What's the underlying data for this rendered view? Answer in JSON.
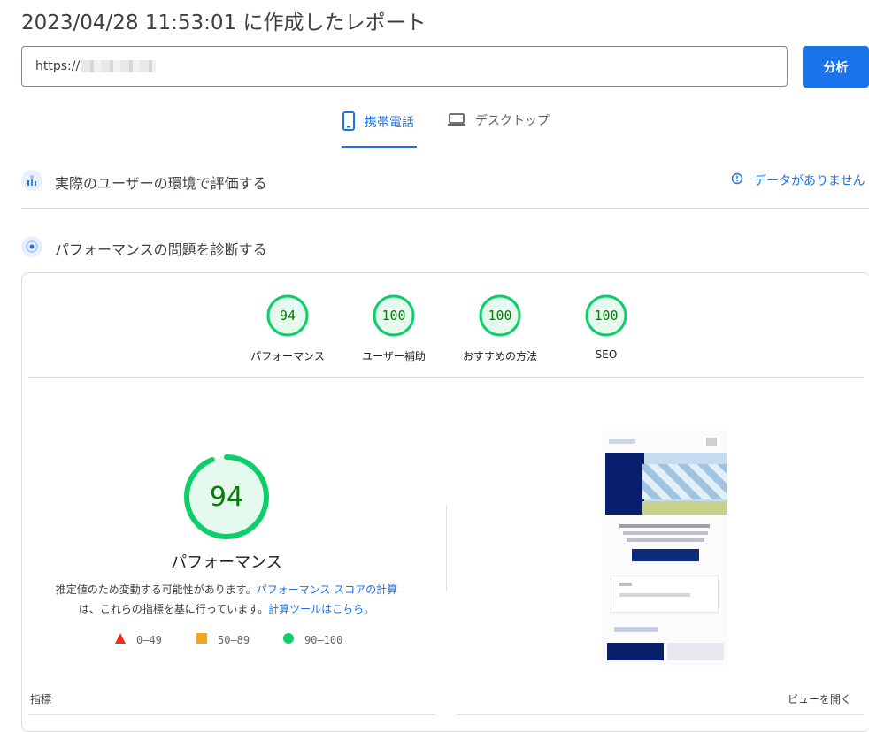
{
  "header": {
    "title": "2023/04/28 11:53:01 に作成したレポート",
    "url_value": "https://",
    "analyze_label": "分析"
  },
  "tabs": [
    {
      "label": "携帯電話",
      "icon": "smartphone-icon",
      "selected": true
    },
    {
      "label": "デスクトップ",
      "icon": "laptop-icon",
      "selected": false
    }
  ],
  "field_data": {
    "title": "実際のユーザーの環境で評価する",
    "no_data": "データがありません"
  },
  "diagnostics": {
    "title": "パフォーマンスの問題を診断する"
  },
  "categories": [
    {
      "score": "94",
      "label": "パフォーマンス"
    },
    {
      "score": "100",
      "label": "ユーザー補助"
    },
    {
      "score": "100",
      "label": "おすすめの方法"
    },
    {
      "score": "100",
      "label": "SEO"
    }
  ],
  "performance": {
    "score": "94",
    "score_fraction": 0.94,
    "label": "パフォーマンス",
    "desc_part1": "推定値のため変動する可能性があります。",
    "link1": "パフォーマンス スコアの計算",
    "desc_part2": "は、これらの指標を基に行っています。",
    "link2": "計算ツールはこちら。"
  },
  "legend": [
    {
      "range": "0–49",
      "color": "#e8321e"
    },
    {
      "range": "50–89",
      "color": "#f4a623"
    },
    {
      "range": "90–100",
      "color": "#0cce6b"
    }
  ],
  "metrics": {
    "label": "指標",
    "expand_label": "ビューを開く"
  },
  "colors": {
    "accent": "#1a73e8",
    "pass": "#0cce6b",
    "pass_text": "#008000",
    "pass_fill": "#e6f9ee"
  }
}
